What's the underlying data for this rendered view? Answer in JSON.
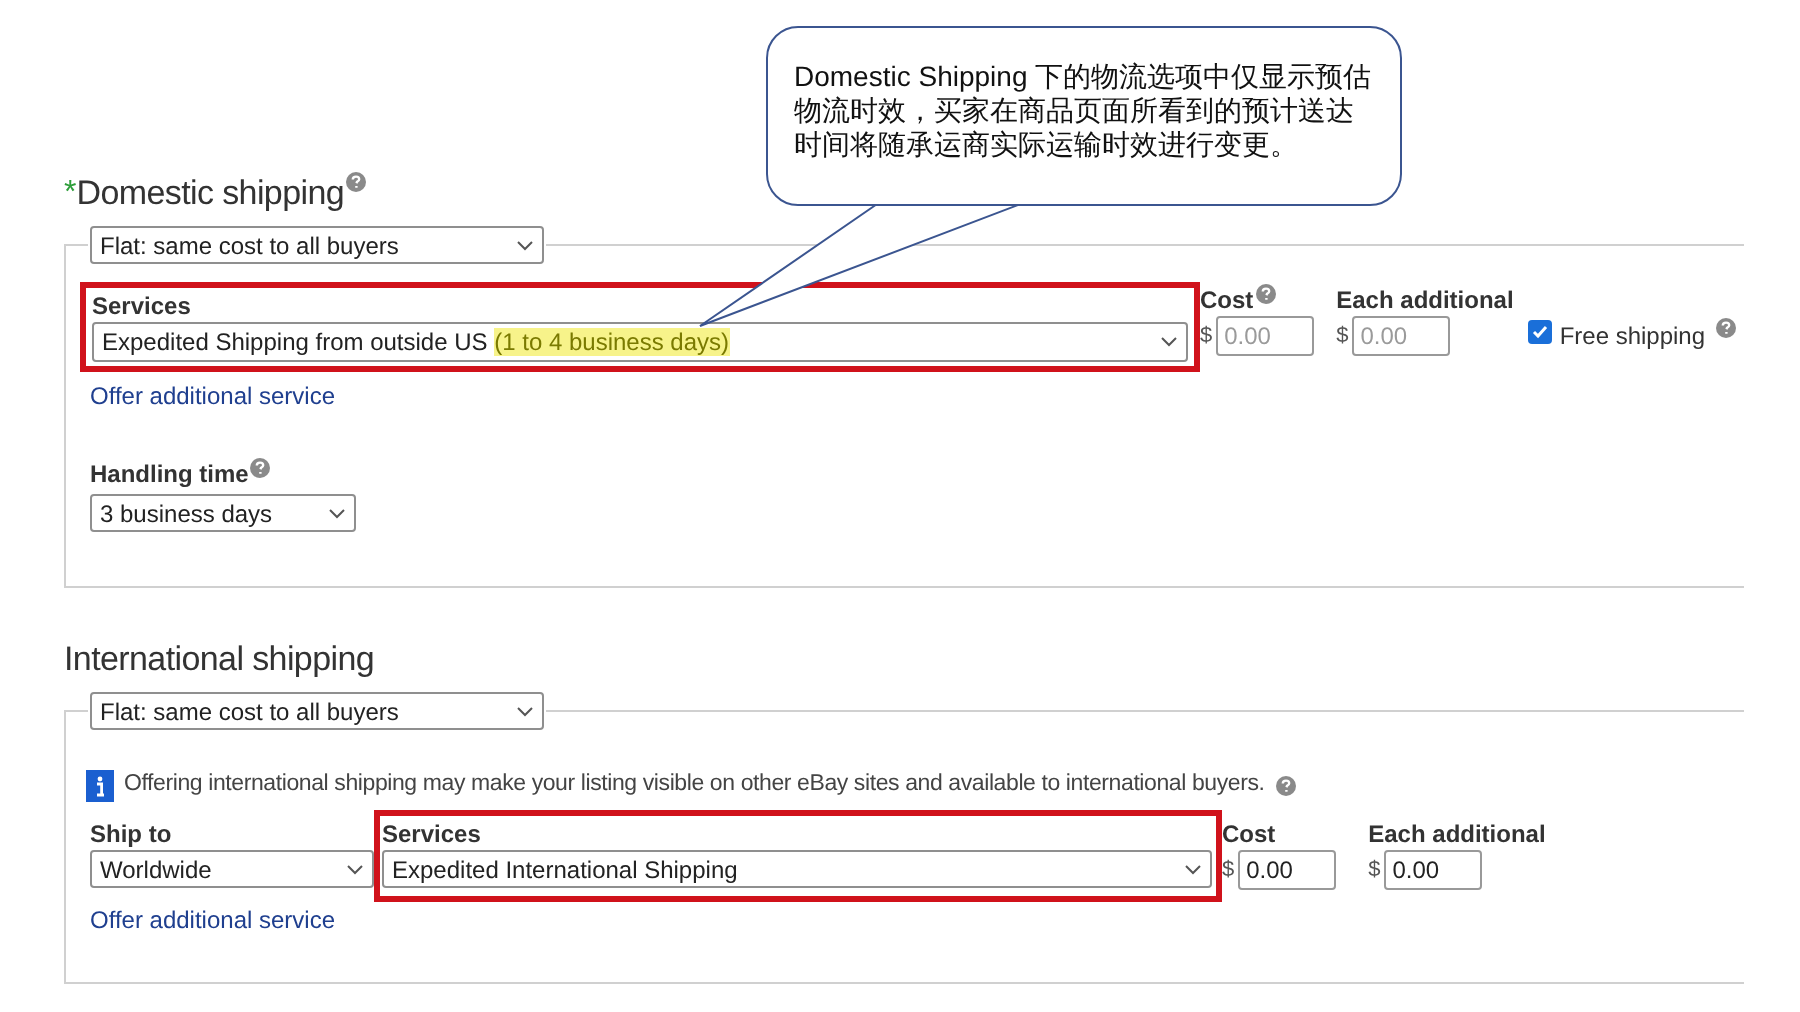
{
  "callout": {
    "text": "Domestic Shipping 下的物流选项中仅显示预估物流时效，买家在商品页面所看到的预计送达时间将随承运商实际运输时效进行变更。"
  },
  "domestic": {
    "required_mark": "*",
    "title": "Domestic shipping",
    "type_select": "Flat: same cost to all buyers",
    "services_label": "Services",
    "service": "Expedited Shipping from outside US ",
    "service_highlight": "(1 to 4 business days)",
    "highlighted": true,
    "cost_label": "Cost",
    "cost_currency": "$",
    "cost_placeholder": "0.00",
    "each_label": "Each additional",
    "each_currency": "$",
    "each_placeholder": "0.00",
    "free_shipping": {
      "label": "Free shipping",
      "checked": true
    },
    "offer_link": "Offer additional service",
    "handling_label": "Handling time",
    "handling": "3 business days"
  },
  "international": {
    "title": "International shipping",
    "type_select": "Flat: same cost to all buyers",
    "info": "Offering international shipping may make your listing visible on other eBay sites and available to international buyers.",
    "ship_to_label": "Ship to",
    "ship_to": "Worldwide",
    "services_label": "Services",
    "service": "Expedited International Shipping",
    "highlighted": true,
    "cost_label": "Cost",
    "cost_currency": "$",
    "cost_value": "0.00",
    "each_label": "Each additional",
    "each_currency": "$",
    "each_value": "0.00",
    "offer_link": "Offer additional service"
  }
}
